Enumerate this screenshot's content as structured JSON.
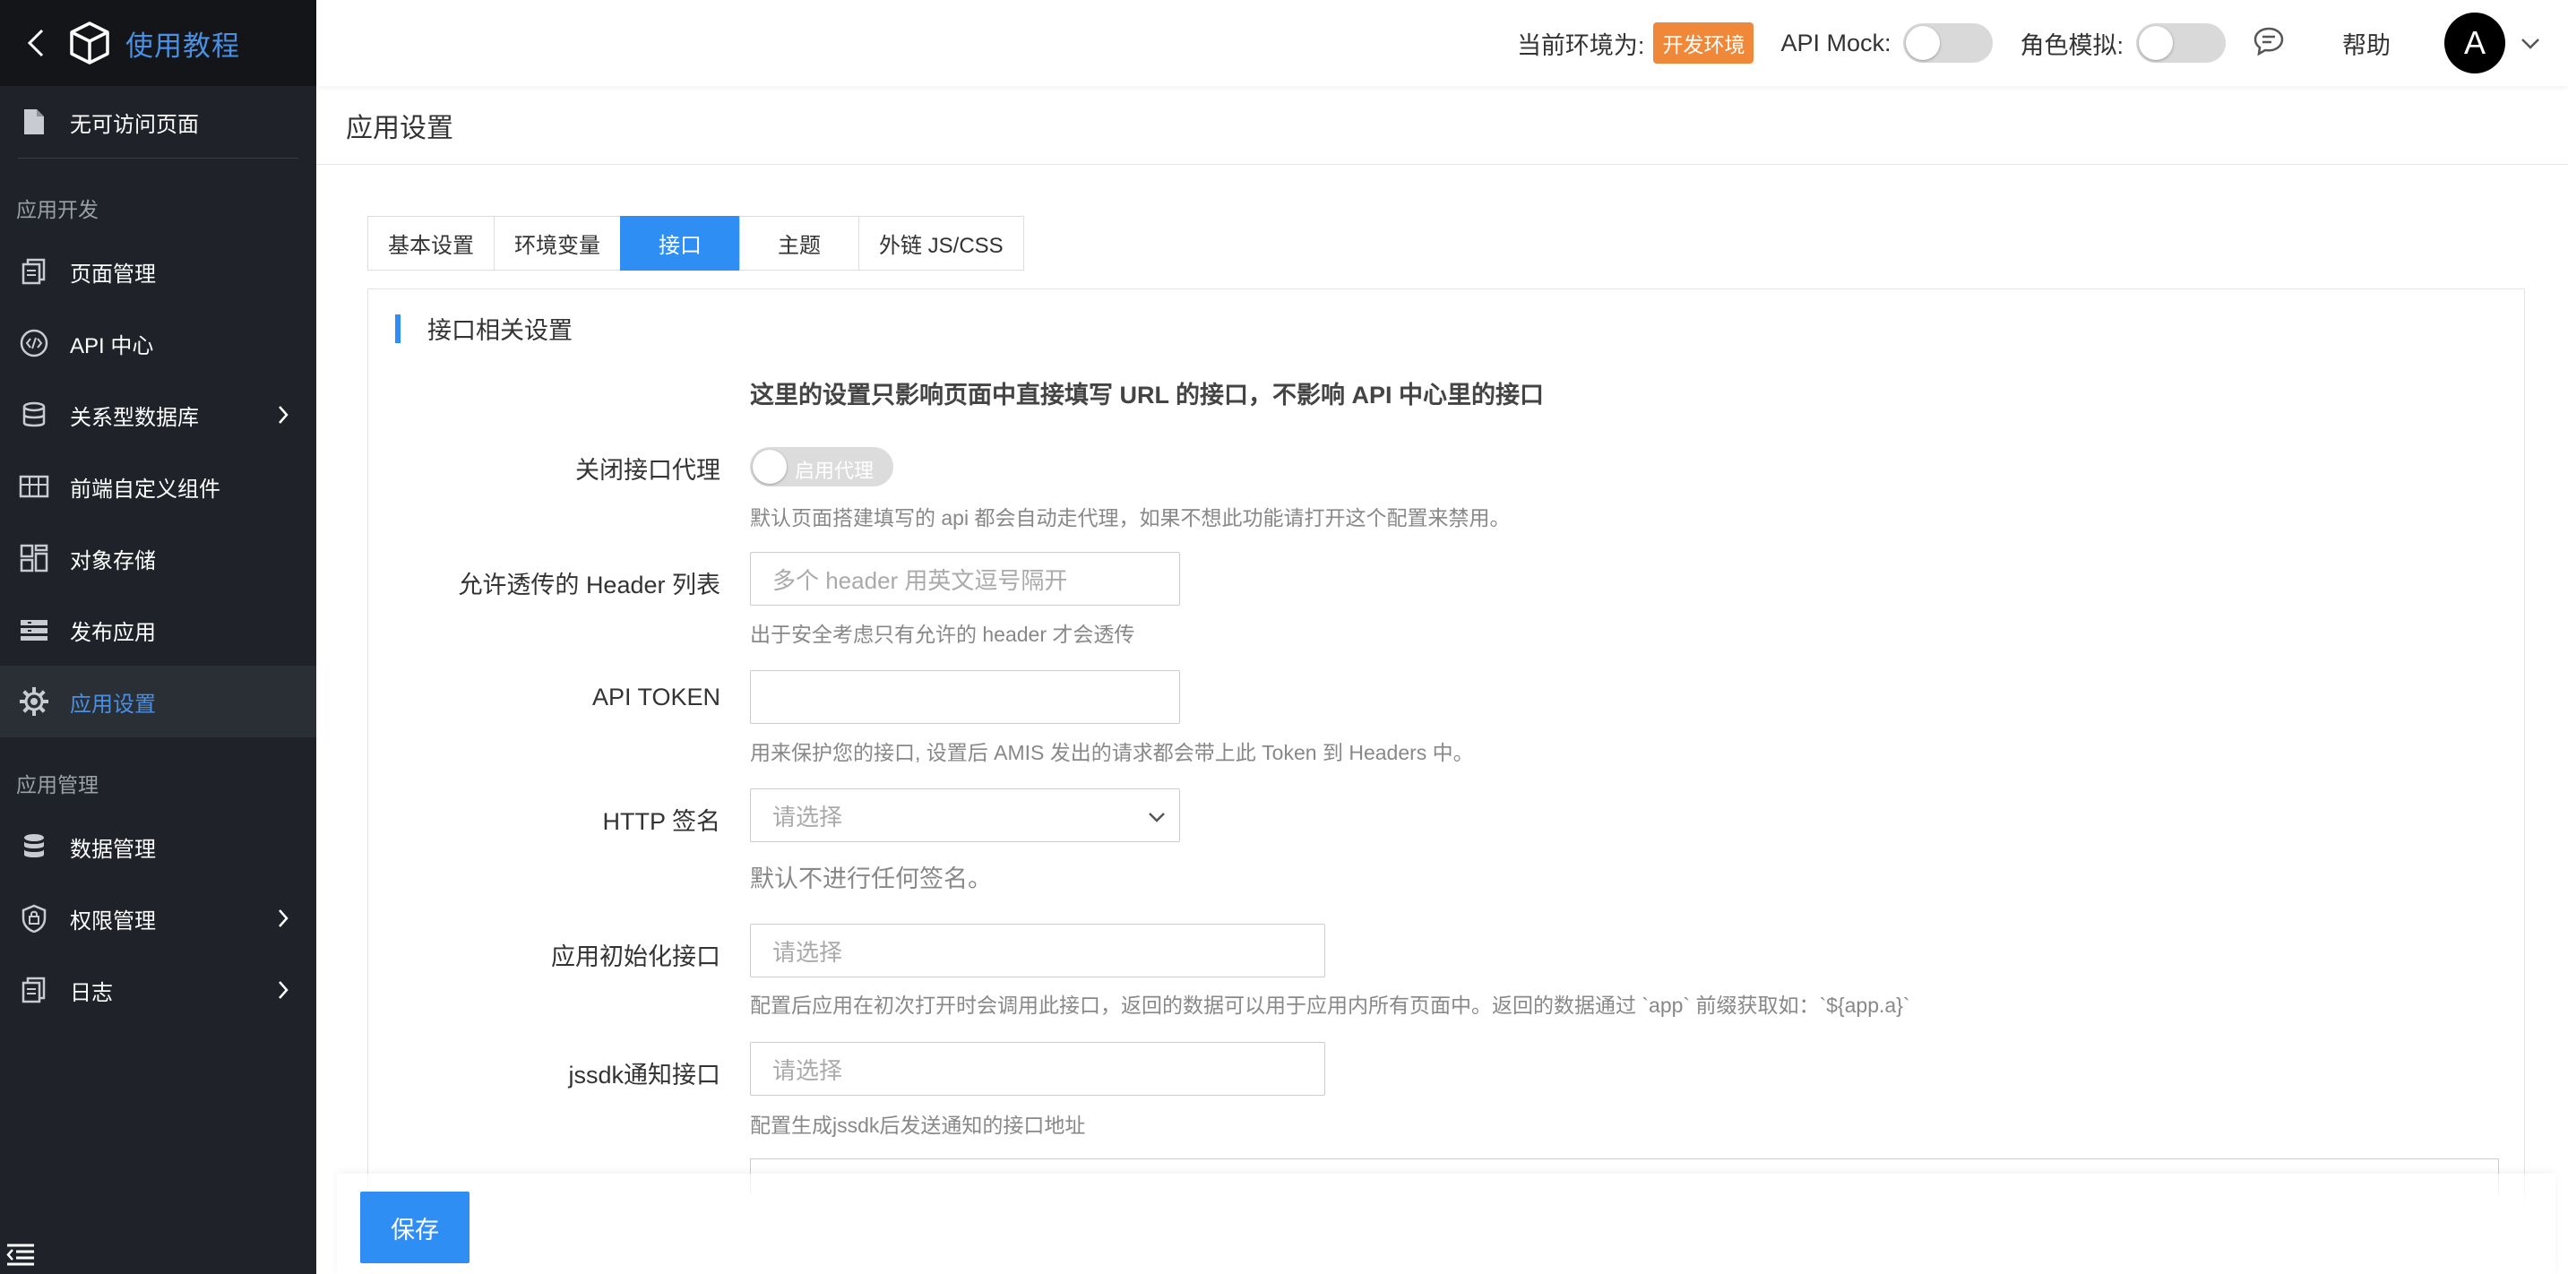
{
  "sidebar": {
    "brand_title": "使用教程",
    "top_item": "无可访问页面",
    "group1": "应用开发",
    "dev_items": [
      {
        "label": "页面管理",
        "icon": "pages-icon"
      },
      {
        "label": "API 中心",
        "icon": "code-icon"
      },
      {
        "label": "关系型数据库",
        "icon": "database-icon",
        "expandable": true
      },
      {
        "label": "前端自定义组件",
        "icon": "components-icon"
      },
      {
        "label": "对象存储",
        "icon": "storage-icon"
      },
      {
        "label": "发布应用",
        "icon": "publish-icon"
      },
      {
        "label": "应用设置",
        "icon": "gear-icon",
        "active": true
      }
    ],
    "group2": "应用管理",
    "mgmt_items": [
      {
        "label": "数据管理",
        "icon": "data-icon"
      },
      {
        "label": "权限管理",
        "icon": "lock-icon",
        "expandable": true
      },
      {
        "label": "日志",
        "icon": "log-icon",
        "expandable": true
      }
    ]
  },
  "topbar": {
    "env_label": "当前环境为:",
    "env_badge": "开发环境",
    "api_mock_label": "API Mock:",
    "role_label": "角色模拟:",
    "help": "帮助",
    "avatar_letter": "A"
  },
  "page": {
    "title": "应用设置",
    "tabs": [
      "基本设置",
      "环境变量",
      "接口",
      "主题",
      "外链 JS/CSS"
    ],
    "active_tab": "接口"
  },
  "section": {
    "title": "接口相关设置",
    "notice": "这里的设置只影响页面中直接填写 URL 的接口，不影响 API 中心里的接口"
  },
  "form": {
    "proxy_label": "关闭接口代理",
    "proxy_switch_text": "启用代理",
    "proxy_hint": "默认页面搭建填写的 api 都会自动走代理，如果不想此功能请打开这个配置来禁用。",
    "header_label": "允许透传的 Header 列表",
    "header_placeholder": "多个 header 用英文逗号隔开",
    "header_hint": "出于安全考虑只有允许的 header 才会透传",
    "token_label": "API TOKEN",
    "token_value": "",
    "token_hint": "用来保护您的接口, 设置后 AMIS 发出的请求都会带上此 Token 到 Headers 中。",
    "sign_label": "HTTP 签名",
    "sign_placeholder": "请选择",
    "sign_hint": "默认不进行任何签名。",
    "init_label": "应用初始化接口",
    "init_placeholder": "请选择",
    "init_hint": "配置后应用在初次打开时会调用此接口，返回的数据可以用于应用内所有页面中。返回的数据通过 `app` 前缀获取如：`${app.a}`",
    "jssdk_label": "jssdk通知接口",
    "jssdk_placeholder": "请选择",
    "jssdk_hint": "配置生成jssdk后发送通知的接口地址"
  },
  "footer": {
    "save_label": "保存"
  },
  "colors": {
    "sidebar_bg": "#1f2228",
    "brand_bg": "#141518",
    "accent": "#2f8ef4",
    "env_badge": "#f0883a"
  }
}
